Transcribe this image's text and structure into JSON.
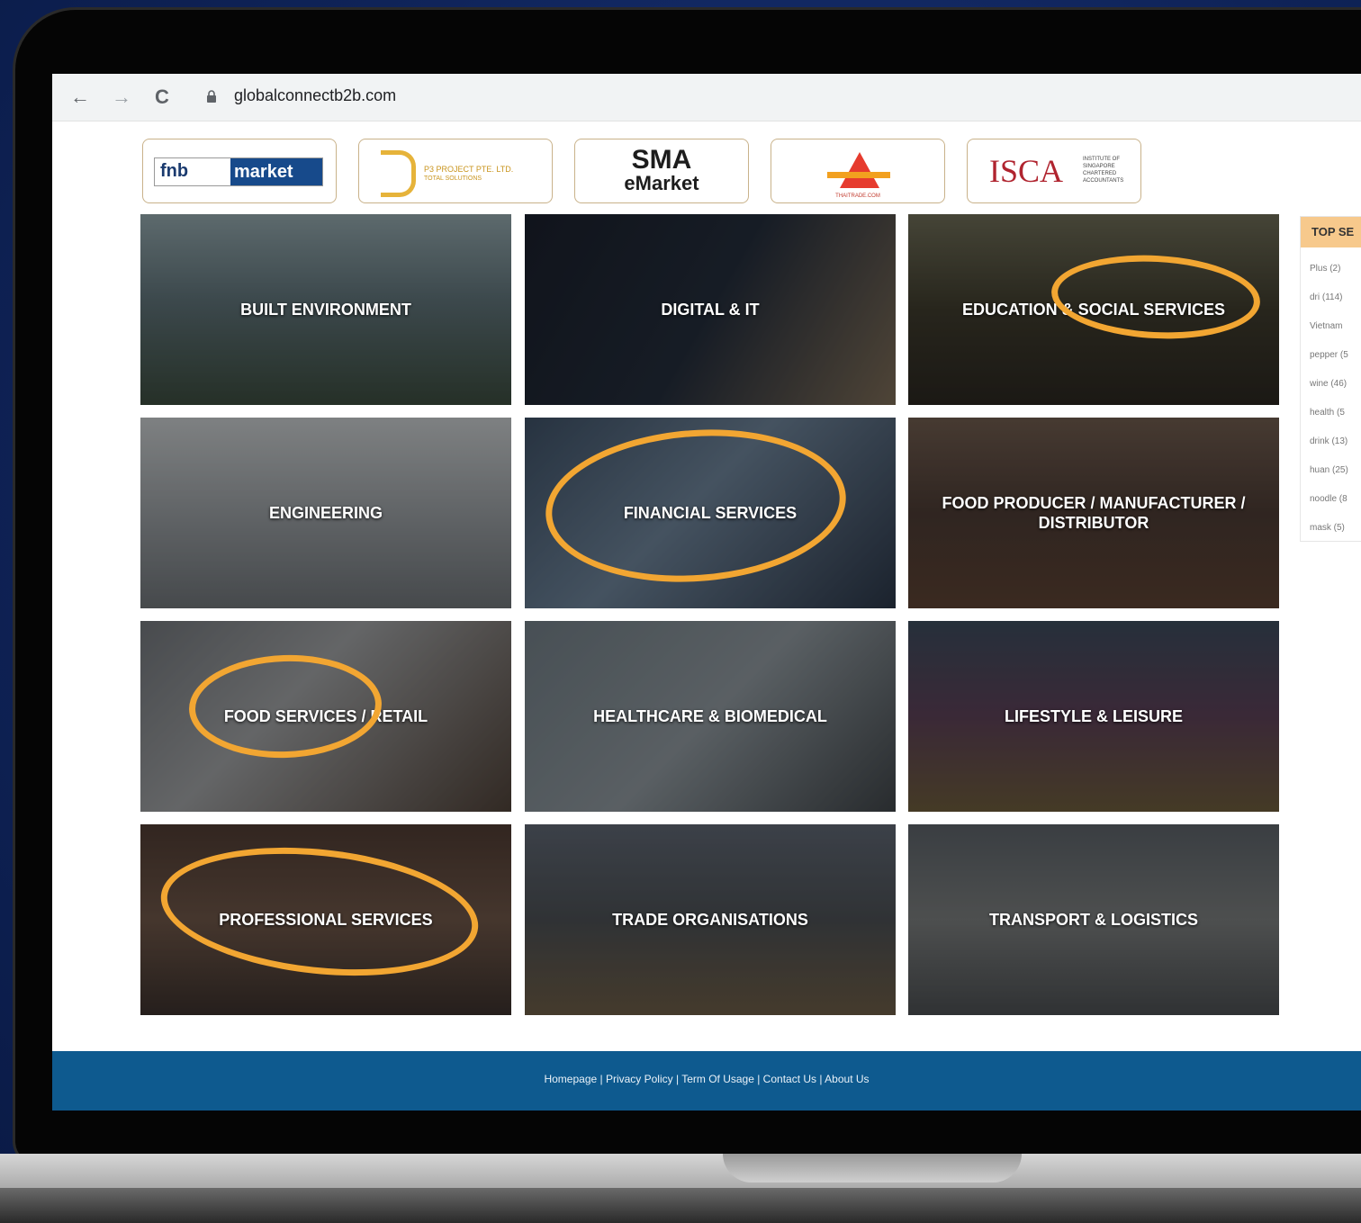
{
  "browser": {
    "url": "globalconnectb2b.com",
    "back_icon": "←",
    "forward_icon": "→",
    "reload_icon": "C"
  },
  "logos": {
    "fnb_a": "fnb",
    "fnb_b": "market",
    "p3_name": "P3 PROJECT PTE. LTD.",
    "p3_tagline": "TOTAL SOLUTIONS",
    "sma_line1": "SMA",
    "sma_line2": "eMarket",
    "thai_name": "THAITRADE.COM",
    "isca_name": "ISCA",
    "isca_sub": "INSTITUTE OF SINGAPORE CHARTERED ACCOUNTANTS"
  },
  "categories": [
    "BUILT ENVIRONMENT",
    "DIGITAL & IT",
    "EDUCATION & SOCIAL SERVICES",
    "ENGINEERING",
    "FINANCIAL SERVICES",
    "FOOD PRODUCER / MANUFACTURER / DISTRIBUTOR",
    "FOOD SERVICES / RETAIL",
    "HEALTHCARE & BIOMEDICAL",
    "LIFESTYLE & LEISURE",
    "PROFESSIONAL SERVICES",
    "TRADE ORGANISATIONS",
    "TRANSPORT & LOGISTICS"
  ],
  "sidebar": {
    "title": "TOP SE",
    "tags": [
      "Plus (2)",
      "dri (114)",
      "Vietnam",
      "pepper (5",
      "wine (46)",
      "health (5",
      "drink (13)",
      "huan (25)",
      "noodle (8",
      "mask (5)"
    ]
  },
  "footer": {
    "links": "Homepage | Privacy Policy | Term Of Usage | Contact Us | About Us"
  },
  "colors": {
    "highlight_ring": "#f2a632",
    "footer": "#0e5a8f",
    "sidebar_header": "#f7c98c"
  }
}
